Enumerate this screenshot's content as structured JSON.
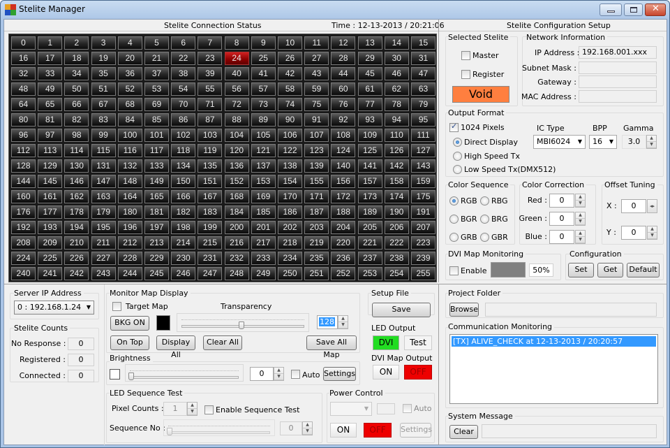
{
  "window": {
    "title": "Stelite Manager",
    "controls": [
      "minimize",
      "maximize",
      "close"
    ]
  },
  "status_panel": {
    "title": "Stelite Connection Status",
    "time_label": "Time : 12-13-2013 / 20:21:06",
    "selected_cell": 24,
    "cell_count": 256,
    "columns": 16
  },
  "config_panel": {
    "title": "Stelite Configuration Setup",
    "selected_stelite": {
      "label": "Selected Stelite",
      "master_label": "Master",
      "master_checked": false,
      "register_label": "Register",
      "register_checked": false,
      "status_label": "Void",
      "status_color": "#ff7f3f"
    },
    "network": {
      "label": "Network Information",
      "ip_label": "IP Address :",
      "ip_value": "192.168.001.xxx",
      "subnet_label": "Subnet Mask :",
      "subnet_value": "",
      "gateway_label": "Gateway :",
      "gateway_value": "",
      "mac_label": "MAC Address :",
      "mac_value": ""
    },
    "output_format": {
      "label": "Output Format",
      "pixels_label": "1024 Pixels",
      "pixels_checked": true,
      "modes": [
        {
          "label": "Direct Display",
          "selected": true
        },
        {
          "label": "High Speed Tx",
          "selected": false
        },
        {
          "label": "Low Speed Tx(DMX512)",
          "selected": false
        }
      ],
      "ic_type_label": "IC Type",
      "ic_type_value": "MBI6024",
      "bpp_label": "BPP",
      "bpp_value": "16",
      "gamma_label": "Gamma",
      "gamma_value": "3.0"
    },
    "color_sequence": {
      "label": "Color Sequence",
      "options": [
        {
          "label": "RGB",
          "selected": true
        },
        {
          "label": "RBG",
          "selected": false
        },
        {
          "label": "BGR",
          "selected": false
        },
        {
          "label": "BRG",
          "selected": false
        },
        {
          "label": "GRB",
          "selected": false
        },
        {
          "label": "GBR",
          "selected": false
        }
      ]
    },
    "color_correction": {
      "label": "Color Correction",
      "red_label": "Red :",
      "red_value": "0",
      "green_label": "Green :",
      "green_value": "0",
      "blue_label": "Blue :",
      "blue_value": "0"
    },
    "offset_tuning": {
      "label": "Offset Tuning",
      "x_label": "X :",
      "x_value": "0",
      "y_label": "Y :",
      "y_value": "0"
    },
    "dvi_map_monitoring": {
      "label": "DVI Map Monitoring",
      "enable_label": "Enable",
      "enable_checked": false,
      "percent_value": "50%"
    },
    "configuration": {
      "label": "Configuration",
      "set_label": "Set",
      "get_label": "Get",
      "default_label": "Default"
    }
  },
  "server": {
    "label": "Server IP Address",
    "value": "0 : 192.168.1.24"
  },
  "counts": {
    "label": "Stelite Counts",
    "no_response_label": "No Response :",
    "no_response_value": "0",
    "registered_label": "Registered :",
    "registered_value": "0",
    "connected_label": "Connected :",
    "connected_value": "0"
  },
  "monitor_map": {
    "label": "Monitor Map Display",
    "target_map_label": "Target Map",
    "target_map_checked": false,
    "transparency_label": "Transparency",
    "transparency_value": "128",
    "transparency_fraction": 0.5,
    "bkg_on_label": "BKG ON",
    "on_top_label": "On Top",
    "display_all_label": "Display All",
    "clear_all_label": "Clear All",
    "save_all_map_label": "Save All Map"
  },
  "brightness": {
    "label": "Brightness",
    "value": "0",
    "fraction": 0,
    "auto_label": "Auto",
    "auto_checked": false,
    "settings_label": "Settings"
  },
  "setup_file": {
    "label": "Setup File",
    "save_label": "Save"
  },
  "led_output": {
    "label": "LED Output",
    "dvi_label": "DVI",
    "dvi_color": "#22dd22",
    "test_label": "Test"
  },
  "dvi_map_output": {
    "label": "DVI Map Output",
    "on_label": "ON",
    "off_label": "OFF",
    "off_color": "#ee0000"
  },
  "led_sequence_test": {
    "label": "LED Sequence Test",
    "pixel_counts_label": "Pixel Counts :",
    "pixel_counts_value": "1",
    "enable_label": "Enable Sequence Test",
    "enable_checked": false,
    "sequence_no_label": "Sequence No :",
    "sequence_no_value": "0"
  },
  "power_control": {
    "label": "Power Control",
    "combo_value": "",
    "field_value": "",
    "auto_label": "Auto",
    "on_label": "ON",
    "off_label": "OFF",
    "settings_label": "Settings"
  },
  "project_folder": {
    "label": "Project Folder",
    "browse_label": "Browse",
    "path_value": ""
  },
  "communication": {
    "label": "Communication Monitoring",
    "entries": [
      "[TX] ALIVE_CHECK at 12-13-2013 / 20:20:57"
    ]
  },
  "system_message": {
    "label": "System Message",
    "clear_label": "Clear",
    "value": ""
  }
}
